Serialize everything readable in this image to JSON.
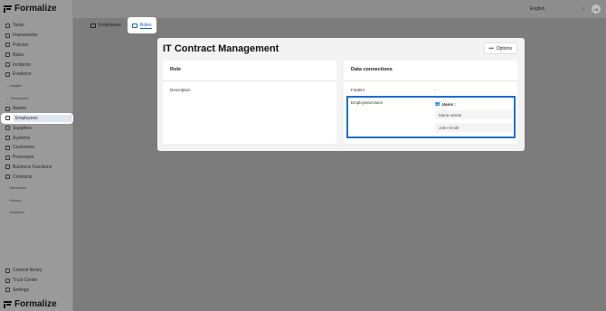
{
  "app": {
    "name": "Formalize"
  },
  "sidebar": {
    "items": [
      {
        "label": "Tasks",
        "icon": "list-icon"
      },
      {
        "label": "Frameworks",
        "icon": "frame-icon"
      },
      {
        "label": "Policies",
        "icon": "shield-icon"
      },
      {
        "label": "Risks",
        "icon": "warning-icon"
      },
      {
        "label": "Incidents",
        "icon": "alert-icon"
      },
      {
        "label": "Evidence",
        "icon": "doc-icon"
      }
    ],
    "group1": "Insights",
    "section_resources": "Resources",
    "resources": [
      {
        "label": "Assets",
        "icon": "box-icon"
      },
      {
        "label": "Employees",
        "icon": "people-icon",
        "active": true
      },
      {
        "label": "Suppliers",
        "icon": "truck-icon"
      },
      {
        "label": "Systems",
        "icon": "server-icon"
      },
      {
        "label": "Customers",
        "icon": "user-icon"
      },
      {
        "label": "Processes",
        "icon": "flow-icon"
      },
      {
        "label": "Business Functions",
        "icon": "chart-icon"
      },
      {
        "label": "Contracts",
        "icon": "contract-icon"
      }
    ],
    "groups": [
      "Workflows",
      "Privacy",
      "Guidance"
    ],
    "bottom": [
      {
        "label": "Content library",
        "icon": "library-icon"
      },
      {
        "label": "Trust Center",
        "icon": "trust-icon"
      },
      {
        "label": "Settings",
        "icon": "gear-icon"
      }
    ]
  },
  "topbar": {
    "language": "English",
    "avatar": "LB"
  },
  "tabs": [
    {
      "label": "Employees"
    },
    {
      "label": "Roles",
      "active": true
    }
  ],
  "page": {
    "title": "IT Contract Management",
    "options_label": "Options"
  },
  "role_panel": {
    "heading": "Role",
    "description_label": "Description"
  },
  "connections": {
    "heading": "Data connections",
    "folders_label": "Folders",
    "folders_value": "-",
    "employees_label": "Employees/Users",
    "users_header": "Users :",
    "users": [
      "Maria Varela",
      "John Smith"
    ]
  },
  "colors": {
    "accent": "#1b6fd0",
    "overlay": "#7e7e7e"
  }
}
